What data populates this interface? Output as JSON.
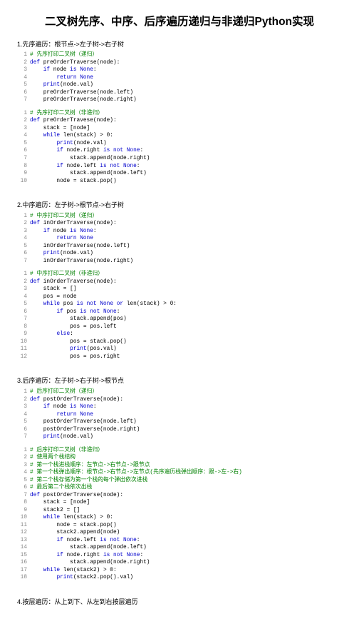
{
  "title": "二叉树先序、中序、后序遍历递归与非递归Python实现",
  "sections": {
    "s1": {
      "label": "1.先序遍历：根节点->左子树->右子树"
    },
    "s2": {
      "label": "2.中序遍历：左子树->根节点->右子树"
    },
    "s3": {
      "label": "3.后序遍历：左子树->右子树->根节点"
    },
    "s4": {
      "label": "4.按层遍历：从上到下、从左到右按层遍历"
    }
  },
  "code": {
    "c1a_cmt": "# 先序打印二叉树（递归）",
    "c1a": [
      "def preOrderTraverse(node):",
      "    if node is None:",
      "        return None",
      "    print(node.val)",
      "    preOrderTraverse(node.left)",
      "    preOrderTraverse(node.right)"
    ],
    "c1b_cmt": "# 先序打印二叉树（非递归）",
    "c1b": [
      "def preOrderTravese(node):",
      "    stack = [node]",
      "    while len(stack) > 0:",
      "        print(node.val)",
      "        if node.right is not None:",
      "            stack.append(node.right)",
      "        if node.left is not None:",
      "            stack.append(node.left)",
      "        node = stack.pop()"
    ],
    "c2a_cmt": "# 中序打印二叉树（递归）",
    "c2a": [
      "def inOrderTraverse(node):",
      "    if node is None:",
      "        return None",
      "    inOrderTraverse(node.left)",
      "    print(node.val)",
      "    inOrderTraverse(node.right)"
    ],
    "c2b_cmt": "# 中序打印二叉树（非递归）",
    "c2b": [
      "def inOrderTraverse(node):",
      "    stack = []",
      "    pos = node",
      "    while pos is not None or len(stack) > 0:",
      "        if pos is not None:",
      "            stack.append(pos)",
      "            pos = pos.left",
      "        else:",
      "            pos = stack.pop()",
      "            print(pos.val)",
      "            pos = pos.right"
    ],
    "c3a_cmt": "# 后序打印二叉树（递归）",
    "c3a": [
      "def postOrderTraverse(node):",
      "    if node is None:",
      "        return None",
      "    postOrderTraverse(node.left)",
      "    postOrderTraverse(node.right)",
      "    print(node.val)"
    ],
    "c3b_cmts": [
      "# 后序打印二叉树（非递归）",
      "# 使用两个栈结构",
      "# 第一个栈进栈顺序：左节点->右节点->跟节点",
      "# 第一个栈弹出顺序：根节点->右节点->左节点(先序遍历栈弹出顺序：跟->左->右)",
      "# 第二个栈存储为第一个栈的每个弹出依次进栈",
      "# 最后第二个栈依次出栈"
    ],
    "c3b": [
      "def postOrderTraverse(node):",
      "    stack = [node]",
      "    stack2 = []",
      "    while len(stack) > 0:",
      "        node = stack.pop()",
      "        stack2.append(node)",
      "        if node.left is not None:",
      "            stack.append(node.left)",
      "        if node.right is not None:",
      "            stack.append(node.right)",
      "    while len(stack2) > 0:",
      "        print(stack2.pop().val)"
    ]
  }
}
